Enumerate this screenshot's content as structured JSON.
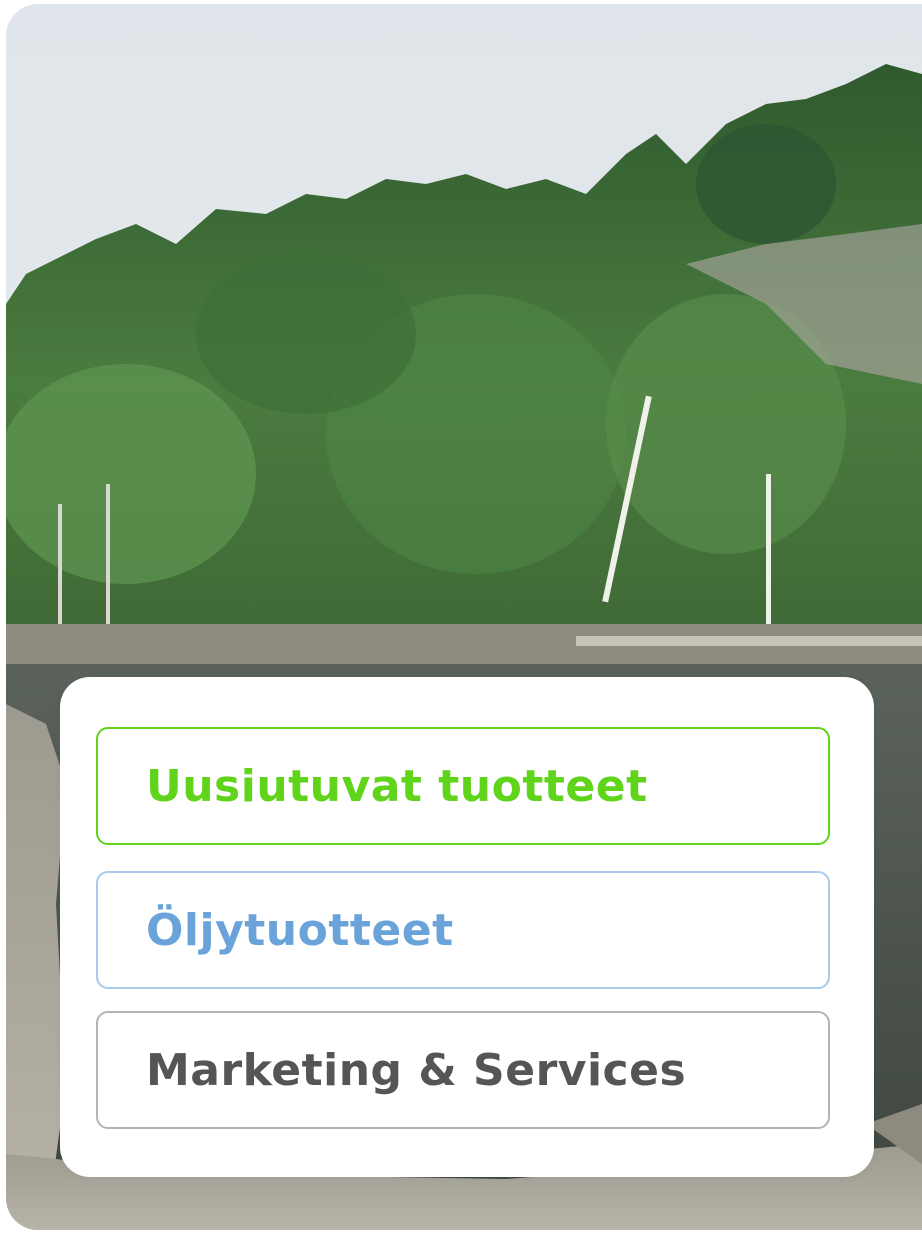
{
  "menu": {
    "items": [
      {
        "label": "Uusiutuvat tuotteet",
        "color": "#5fd41b",
        "border": "#5fd41b"
      },
      {
        "label": "Öljytuotteet",
        "color": "#6aa3d9",
        "border": "#a9cbe9"
      },
      {
        "label": "Marketing & Services",
        "color": "#555555",
        "border": "#b4b4b4"
      }
    ]
  },
  "background": {
    "image": "lakeside-forest-photo",
    "colors": {
      "sky": "#e7ebee",
      "forest": "#3f6b3a",
      "rock": "#a9a79f",
      "water": "#4d564d"
    }
  }
}
